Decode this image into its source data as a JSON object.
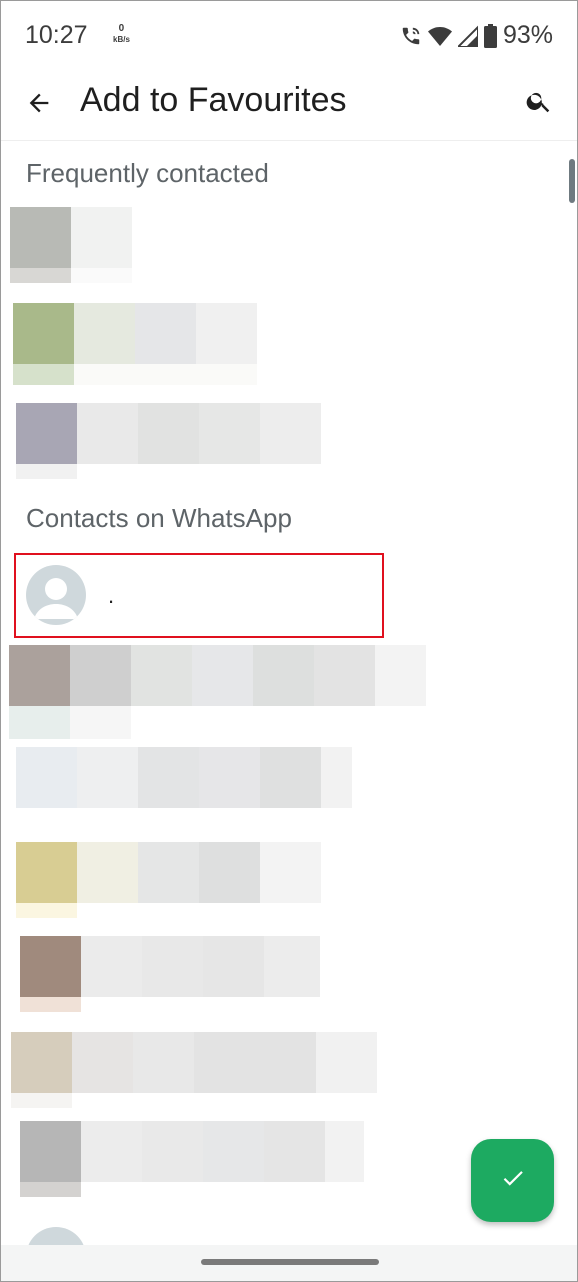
{
  "status_bar": {
    "time": "10:27",
    "net_speed_value": "0",
    "net_speed_unit": "kB/s",
    "battery_percent": "93%",
    "icons": [
      "wifi-call-icon",
      "wifi-icon",
      "signal-icon",
      "battery-icon"
    ]
  },
  "app_bar": {
    "title": "Add to Favourites",
    "back_icon": "arrow-back-icon",
    "search_icon": "search-icon"
  },
  "sections": {
    "frequent": "Frequently contacted",
    "whatsapp": "Contacts on WhatsApp"
  },
  "highlighted_contact": {
    "name": "."
  },
  "fab": {
    "icon": "check-icon",
    "color": "#1daa61"
  },
  "colors": {
    "highlight_border": "#e0101e",
    "accent": "#1daa61"
  }
}
